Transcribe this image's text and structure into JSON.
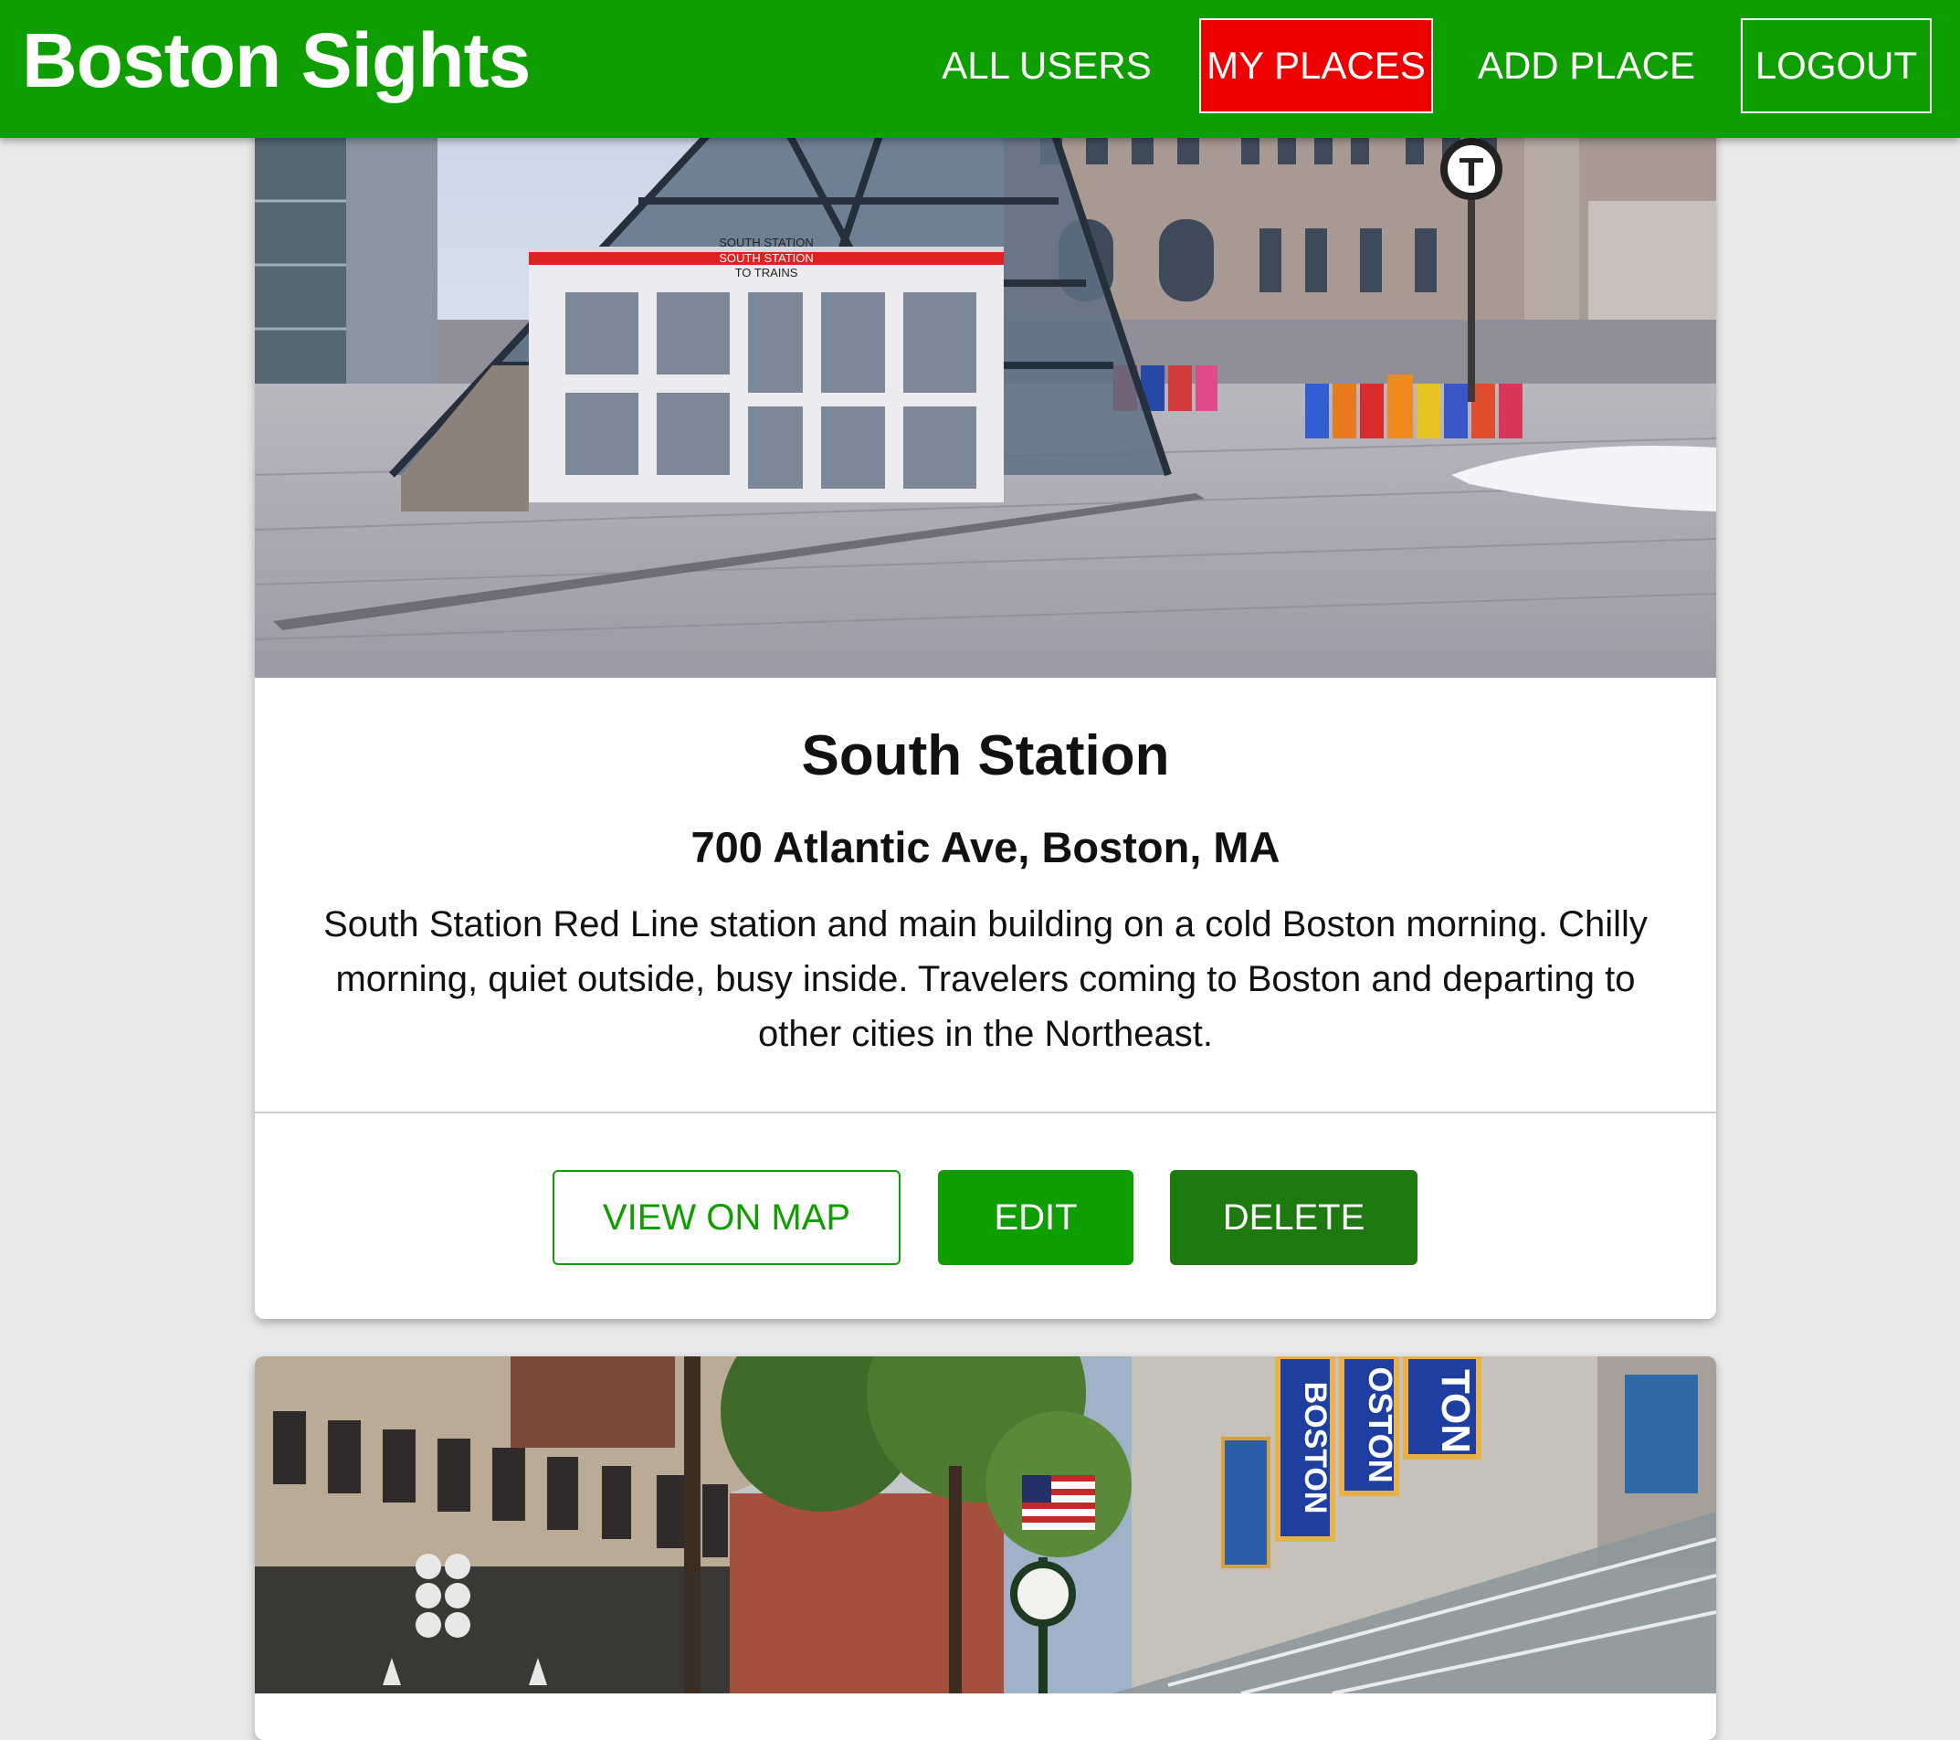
{
  "header": {
    "brand": "Boston Sights",
    "nav": {
      "all_users": "ALL USERS",
      "my_places": "MY PLACES",
      "add_place": "ADD PLACE",
      "logout": "LOGOUT"
    }
  },
  "places": [
    {
      "title": "South Station",
      "address": "700 Atlantic Ave, Boston, MA",
      "description": "South Station Red Line station and main building on a cold Boston morning. Chilly morning, quiet outside, busy inside. Travelers coming to Boston and departing to other cities in the Northeast.",
      "image_alt": "South Station entrance photo",
      "sign_text": [
        "SOUTH STATION",
        "SOUTH STATION",
        "TO TRAINS"
      ],
      "actions": {
        "view_on_map": "VIEW ON MAP",
        "edit": "EDIT",
        "delete": "DELETE"
      }
    },
    {
      "image_alt": "Faneuil Hall Marketplace photo",
      "banner_text": [
        "TON",
        "OSTON",
        "BOSTON"
      ]
    }
  ],
  "colors": {
    "brand_green": "#0f9e00",
    "active_red": "#ee0000",
    "delete_green": "#1e7a10",
    "background": "#e9e9e9"
  }
}
